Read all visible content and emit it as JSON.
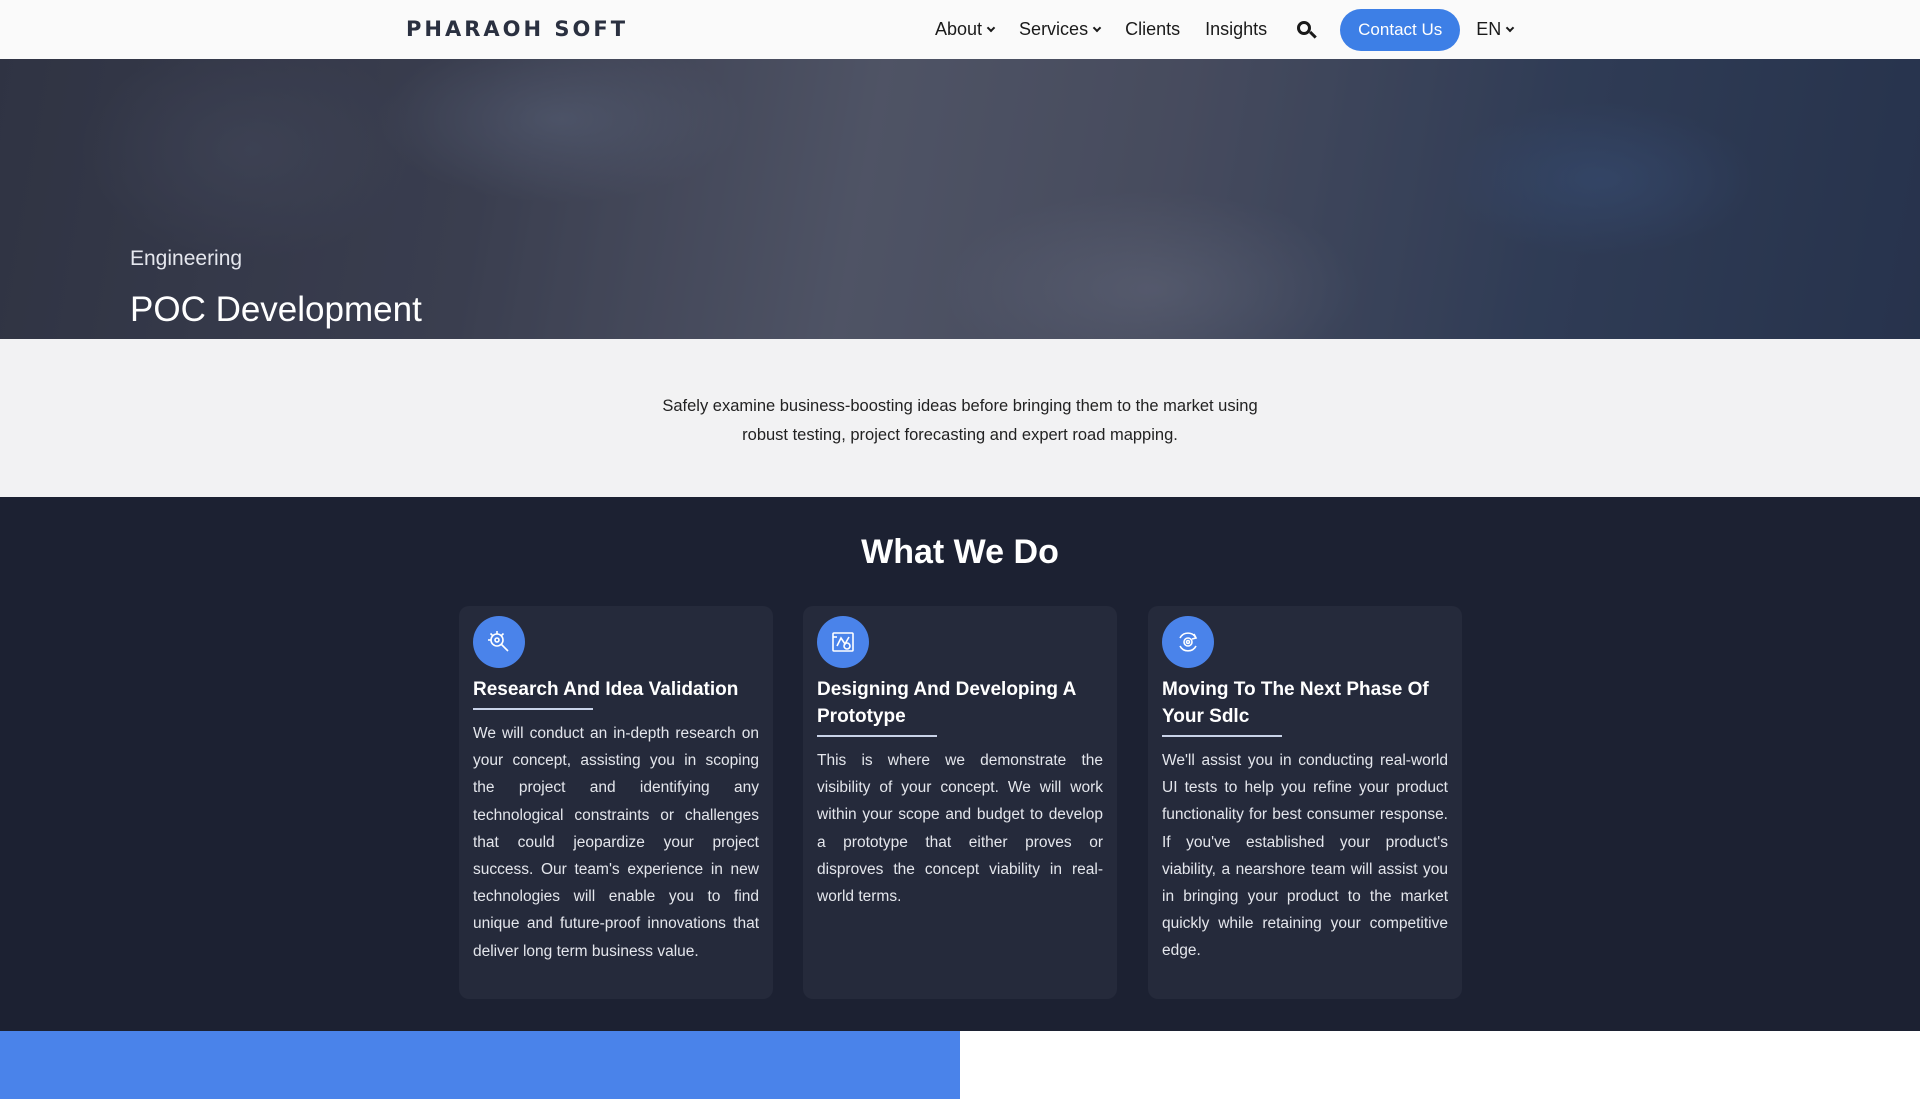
{
  "header": {
    "logo_text": "PHARAOH SOFT",
    "nav": [
      {
        "label": "About",
        "has_dropdown": true
      },
      {
        "label": "Services",
        "has_dropdown": true
      },
      {
        "label": "Clients",
        "has_dropdown": false
      },
      {
        "label": "Insights",
        "has_dropdown": false
      }
    ],
    "contact_label": "Contact Us",
    "language": "EN"
  },
  "hero": {
    "category": "Engineering",
    "title": "POC Development"
  },
  "intro": {
    "text": "Safely examine business-boosting ideas before bringing them to the market using robust testing, project forecasting and expert road mapping."
  },
  "services": {
    "title": "What We Do",
    "cards": [
      {
        "icon": "research-gear-icon",
        "title": "Research And Idea Validation",
        "text": "We will conduct an in-depth research on your concept, assisting you in scoping the project and identifying any technological constraints or challenges that could jeopardize your project success. Our team's experience in new technologies will enable you to find unique and future-proof innovations that deliver long term business value."
      },
      {
        "icon": "prototype-blueprint-icon",
        "title": "Designing And Developing A Prototype",
        "text": "This is where we demonstrate the visibility of your concept. We will work within your scope and budget to develop a prototype that either proves or disproves the concept viability in real-world terms."
      },
      {
        "icon": "cycle-target-icon",
        "title": "Moving To The Next Phase Of Your Sdlc",
        "text": "We'll assist you in conducting real-world UI tests to help you refine your product functionality for best consumer response. If you've established your product's viability, a nearshore team will assist you in bringing your product to the market quickly while retaining your competitive edge."
      }
    ]
  },
  "colors": {
    "accent": "#4a83ea",
    "dark_bg": "#1c2132",
    "card_bg": "#252a3b"
  }
}
